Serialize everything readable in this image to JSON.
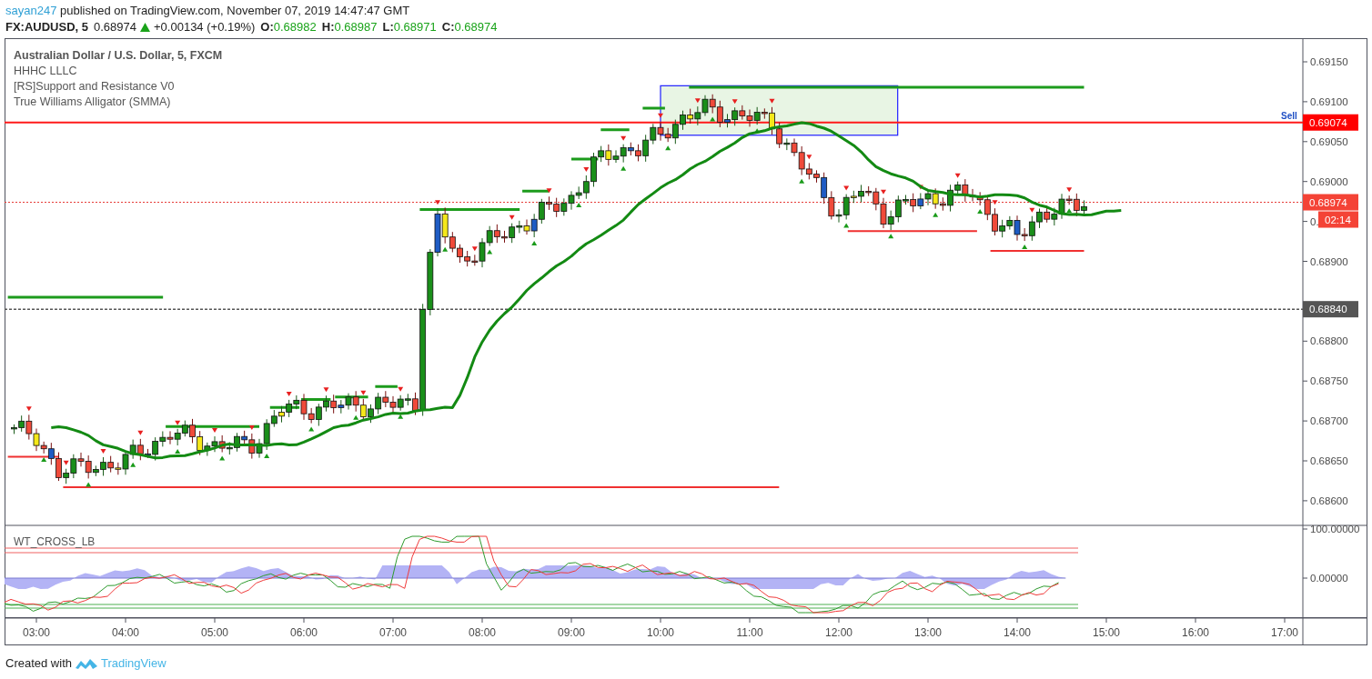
{
  "header": {
    "author": "sayan247",
    "published": "published on TradingView.com, November 07, 2019 14:47:47 GMT"
  },
  "symbol_line": {
    "symbol": "FX:AUDUSD, 5",
    "price": "0.68974",
    "change": "+0.00134 (+0.19%)",
    "ohlc": [
      {
        "label": "O:",
        "value": "0.68982"
      },
      {
        "label": "H:",
        "value": "0.68987"
      },
      {
        "label": "L:",
        "value": "0.68971"
      },
      {
        "label": "C:",
        "value": "0.68974"
      }
    ]
  },
  "legend": [
    "Australian Dollar / U.S. Dollar, 5, FXCM",
    "HHHC LLLC",
    "[RS]Support and Resistance V0",
    "True Williams Alligator (SMMA)"
  ],
  "price_axis": {
    "ticks": [
      "0.69150",
      "0.69100",
      "0.69050",
      "0.69000",
      "0.",
      "0.68900",
      "0.68800",
      "0.68750",
      "0.68700",
      "0.68650",
      "0.68600"
    ]
  },
  "price_tags": [
    {
      "kind": "sell",
      "marker": "Sell",
      "value": "0.69074"
    },
    {
      "kind": "last",
      "value": "0.68974"
    },
    {
      "kind": "countdown",
      "value": "02:14"
    },
    {
      "kind": "line",
      "value": "0.68840"
    }
  ],
  "oscillator": {
    "title": "WT_CROSS_LB",
    "ticks": [
      "100.00000",
      "0.00000"
    ]
  },
  "time_axis": [
    "03:00",
    "04:00",
    "05:00",
    "06:00",
    "07:00",
    "08:00",
    "09:00",
    "10:00",
    "11:00",
    "12:00",
    "13:00",
    "14:00",
    "15:00",
    "16:00",
    "17:00"
  ],
  "footer": {
    "text": "Created with",
    "brand": "TradingView"
  }
}
